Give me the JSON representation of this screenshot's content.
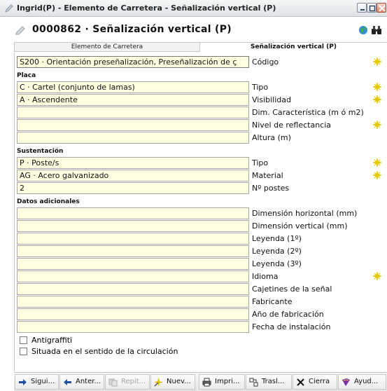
{
  "window": {
    "title": "Ingrid(P) - Elemento de Carretera - Señalización vertical (P)"
  },
  "header": {
    "record_title": "0000862 · Señalización vertical (P)"
  },
  "tabs": [
    {
      "label": "Elemento de Carretera",
      "active": false
    },
    {
      "label": "Señalización vertical (P)",
      "active": true
    }
  ],
  "codigo": {
    "value": "S200 · Orientación preseñalización, Preseñalización de ç",
    "label": "Código"
  },
  "sections": {
    "placa": "Placa",
    "sustentacion": "Sustentación",
    "datos": "Datos adicionales"
  },
  "placa": [
    {
      "value": "C · Cartel (conjunto de lamas)",
      "label": "Tipo",
      "star": true
    },
    {
      "value": "A · Ascendente",
      "label": "Visibilidad",
      "star": true
    },
    {
      "value": "",
      "label": "Dim. Característica (m ó m2)",
      "star": false
    },
    {
      "value": "",
      "label": "Nivel de reflectancia",
      "star": true
    },
    {
      "value": "",
      "label": "Altura (m)",
      "star": false
    }
  ],
  "sustentacion": [
    {
      "value": "P · Poste/s",
      "label": "Tipo",
      "star": true
    },
    {
      "value": "AG · Acero galvanizado",
      "label": "Material",
      "star": true
    },
    {
      "value": "2",
      "label": "Nº postes",
      "star": false
    }
  ],
  "datos": [
    {
      "value": "",
      "label": "Dimensión horizontal (mm)",
      "star": false
    },
    {
      "value": "",
      "label": "Dimensión vertical (mm)",
      "star": false
    },
    {
      "value": "",
      "label": "Leyenda (1º)",
      "star": false
    },
    {
      "value": "",
      "label": "Leyenda (2º)",
      "star": false
    },
    {
      "value": "",
      "label": "Leyenda (3º)",
      "star": false
    },
    {
      "value": "",
      "label": "Idioma",
      "star": true
    },
    {
      "value": "",
      "label": "Cajetines de la señal",
      "star": false
    },
    {
      "value": "",
      "label": "Fabricante",
      "star": false
    },
    {
      "value": "",
      "label": "Año de fabricación",
      "star": false
    },
    {
      "value": "",
      "label": "Fecha de instalación",
      "star": false
    }
  ],
  "checkboxes": [
    {
      "label": "Antigraffiti",
      "checked": false
    },
    {
      "label": "Situada en el sentido de la circulación",
      "checked": false
    }
  ],
  "toolbar": {
    "siguiente": "Sigui...",
    "anterior": "Anter...",
    "repetir": "Repit...",
    "nuevo": "Nuev...",
    "imprimir": "Impri...",
    "trasladar": "Trasl...",
    "cerrar": "Cierra",
    "ayuda": "Ayud..."
  },
  "colors": {
    "field_bg": "#ffffe1",
    "required_star": "#e6c800"
  }
}
